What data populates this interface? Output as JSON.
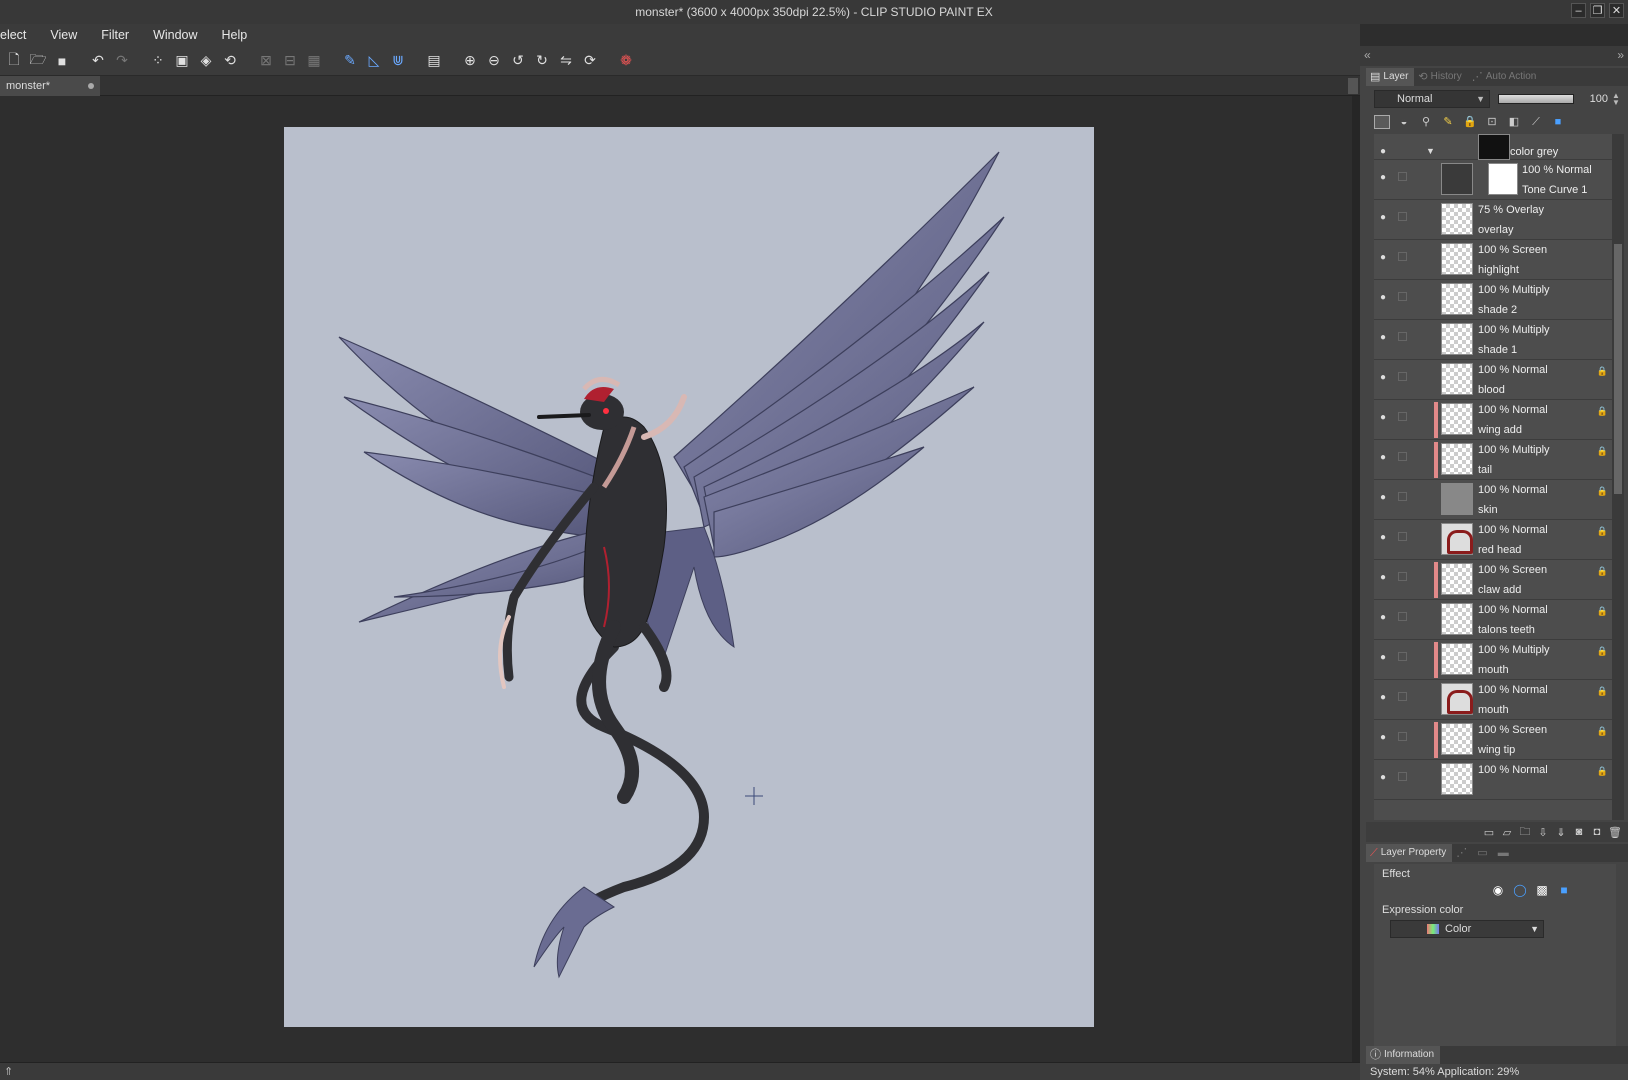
{
  "window": {
    "title": "monster* (3600 x 4000px 350dpi 22.5%)  - CLIP STUDIO PAINT EX",
    "controls": [
      "minimize-icon",
      "maximize-icon",
      "close-icon"
    ]
  },
  "menu": [
    "elect",
    "View",
    "Filter",
    "Window",
    "Help"
  ],
  "toolbar_icons": [
    "new-file-icon",
    "open-file-icon",
    "save-icon",
    "undo-icon",
    "redo-icon",
    "transform-icon",
    "select-all-icon",
    "fill-icon",
    "rotate-icon",
    "crop-icon",
    "ruler-icon",
    "perspective-icon",
    "pen-icon",
    "ruler-snap-icon",
    "zoom-in-icon",
    "zoom-out-icon",
    "rotate-left-icon",
    "rotate-right-icon",
    "flip-icon",
    "reset-icon",
    "color-wheel-icon"
  ],
  "document_tab": {
    "label": "monster*"
  },
  "layer_panel": {
    "tabs": [
      "Layer",
      "History",
      "Auto Action"
    ],
    "blend_mode": "Normal",
    "opacity": "100",
    "folder": {
      "name": "color grey"
    },
    "tone_curve": {
      "mode": "100 % Normal",
      "name": "Tone Curve 1"
    },
    "layers": [
      {
        "mode": "75 % Overlay",
        "name": "overlay",
        "marked": false,
        "locked": false,
        "thumb": "check"
      },
      {
        "mode": "100 % Screen",
        "name": "highlight",
        "marked": false,
        "locked": false,
        "thumb": "check"
      },
      {
        "mode": "100 % Multiply",
        "name": "shade 2",
        "marked": false,
        "locked": false,
        "thumb": "check"
      },
      {
        "mode": "100 % Multiply",
        "name": "shade 1",
        "marked": false,
        "locked": false,
        "thumb": "check"
      },
      {
        "mode": "100 % Normal",
        "name": "blood",
        "marked": false,
        "locked": true,
        "thumb": "check"
      },
      {
        "mode": "100 % Normal",
        "name": "wing add",
        "marked": true,
        "locked": true,
        "thumb": "check"
      },
      {
        "mode": "100 % Multiply",
        "name": "tail",
        "marked": true,
        "locked": true,
        "thumb": "check"
      },
      {
        "mode": "100 % Normal",
        "name": "skin",
        "marked": false,
        "locked": true,
        "thumb": "grey"
      },
      {
        "mode": "100 % Normal",
        "name": "red head",
        "marked": false,
        "locked": true,
        "thumb": "red"
      },
      {
        "mode": "100 % Screen",
        "name": "claw add",
        "marked": true,
        "locked": true,
        "thumb": "check"
      },
      {
        "mode": "100 % Normal",
        "name": "talons teeth",
        "marked": false,
        "locked": true,
        "thumb": "check"
      },
      {
        "mode": "100 % Multiply",
        "name": "mouth",
        "marked": true,
        "locked": true,
        "thumb": "check"
      },
      {
        "mode": "100 % Normal",
        "name": "mouth",
        "marked": false,
        "locked": true,
        "thumb": "red"
      },
      {
        "mode": "100 % Screen",
        "name": "wing tip",
        "marked": true,
        "locked": true,
        "thumb": "check"
      },
      {
        "mode": "100 % Normal",
        "name": "",
        "marked": false,
        "locked": true,
        "thumb": "check"
      }
    ]
  },
  "property_panel": {
    "tabs": [
      "Layer Property"
    ],
    "effect_label": "Effect",
    "expression_color_label": "Expression color",
    "expression_color_value": "Color"
  },
  "info_panel": {
    "tab": "Information",
    "text": "System: 54%  Application: 29%"
  },
  "colors": {
    "paper": "#b9bfcc",
    "wing": "#6e6f94",
    "body": "#2f2f33",
    "accent_red": "#b02030",
    "layer_marker": "#e28a8a"
  }
}
